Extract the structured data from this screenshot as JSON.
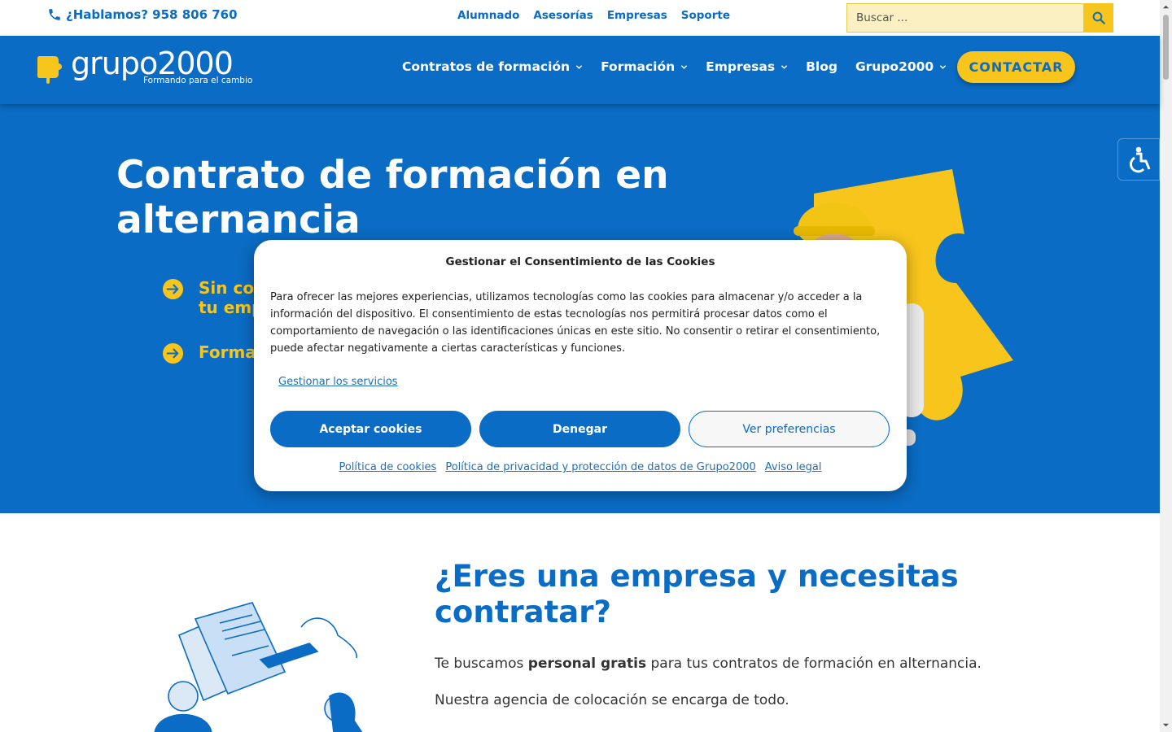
{
  "topbar": {
    "phone_label": "¿Hablamos? 958 806 760",
    "links": [
      "Alumnado",
      "Asesorías",
      "Empresas",
      "Soporte"
    ],
    "search_placeholder": "Buscar ..."
  },
  "nav": {
    "logo_text": "grupo2000",
    "logo_tagline": "Formando para el cambio",
    "menu": [
      {
        "label": "Contratos de formación",
        "has_dropdown": true
      },
      {
        "label": "Formación",
        "has_dropdown": true
      },
      {
        "label": "Empresas",
        "has_dropdown": true
      },
      {
        "label": "Blog",
        "has_dropdown": false
      },
      {
        "label": "Grupo2000",
        "has_dropdown": true
      }
    ],
    "contact_label": "CONTACTAR"
  },
  "hero": {
    "title": "Contrato de formación en alternancia",
    "bullets": [
      "Sin cos\ntu emp",
      "Formac"
    ]
  },
  "content": {
    "heading": "¿Eres una empresa y necesitas contratar?",
    "p1_pre": "Te buscamos ",
    "p1_bold": "personal gratis",
    "p1_post": " para tus contratos de formación en alternancia.",
    "p2": "Nuestra agencia de colocación se encarga de todo."
  },
  "cookie_modal": {
    "title": "Gestionar el Consentimiento de las Cookies",
    "body": "Para ofrecer las mejores experiencias, utilizamos tecnologías como las cookies para almacenar y/o acceder a la información del dispositivo. El consentimiento de estas tecnologías nos permitirá procesar datos como el comportamiento de navegación o las identificaciones únicas en este sitio. No consentir o retirar el consentimiento, puede afectar negativamente a ciertas características y funciones.",
    "manage_services": "Gestionar los servicios",
    "accept": "Aceptar cookies",
    "deny": "Denegar",
    "preferences": "Ver preferencias",
    "links": [
      "Política de cookies",
      "Política de privacidad y protección de datos de Grupo2000",
      "Aviso legal"
    ]
  },
  "colors": {
    "brand_blue": "#0a6cc4",
    "brand_yellow": "#f8c51c"
  },
  "icons": [
    "phone-icon",
    "search-icon",
    "chevron-down-icon",
    "arrow-right-circle-icon",
    "accessibility-icon"
  ]
}
